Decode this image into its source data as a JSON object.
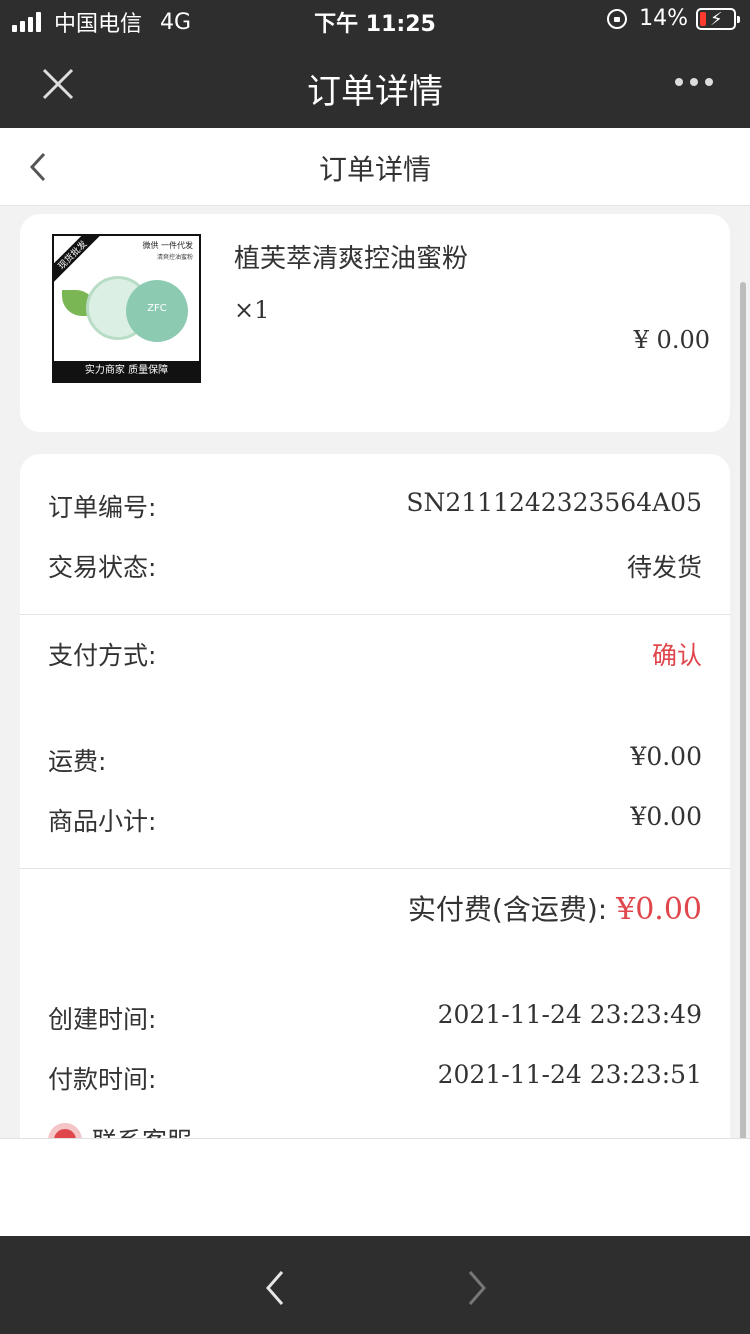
{
  "status_bar": {
    "carrier": "中国电信",
    "network": "4G",
    "time": "下午 11:25",
    "battery": "14%"
  },
  "title_bar": {
    "title": "订单详情"
  },
  "page_header": {
    "title": "订单详情"
  },
  "product": {
    "name": "植芙萃清爽控油蜜粉",
    "quantity": "×1",
    "price": "¥ 0.00",
    "image": {
      "ribbon": "现货批发",
      "tagline": "微供 一件代发",
      "subline": "清爽控油蜜粉",
      "brand": "ZFC",
      "footer": "实力商家 质量保障"
    }
  },
  "order": {
    "number_label": "订单编号:",
    "number_value": "SN2111242323564A05",
    "status_label": "交易状态:",
    "status_value": "待发货",
    "payment_label": "支付方式:",
    "payment_value": "确认",
    "shipping_label": "运费:",
    "shipping_value": "¥0.00",
    "subtotal_label": "商品小计:",
    "subtotal_value": "¥0.00",
    "total_label": "实付费(含运费):",
    "total_value": "¥0.00",
    "created_label": "创建时间:",
    "created_value": "2021-11-24 23:23:49",
    "paid_label": "付款时间:",
    "paid_value": "2021-11-24 23:23:51",
    "contact_label": "联系客服"
  },
  "colors": {
    "accent_red": "#e0474c",
    "bar_dark": "#2e2e2e"
  }
}
